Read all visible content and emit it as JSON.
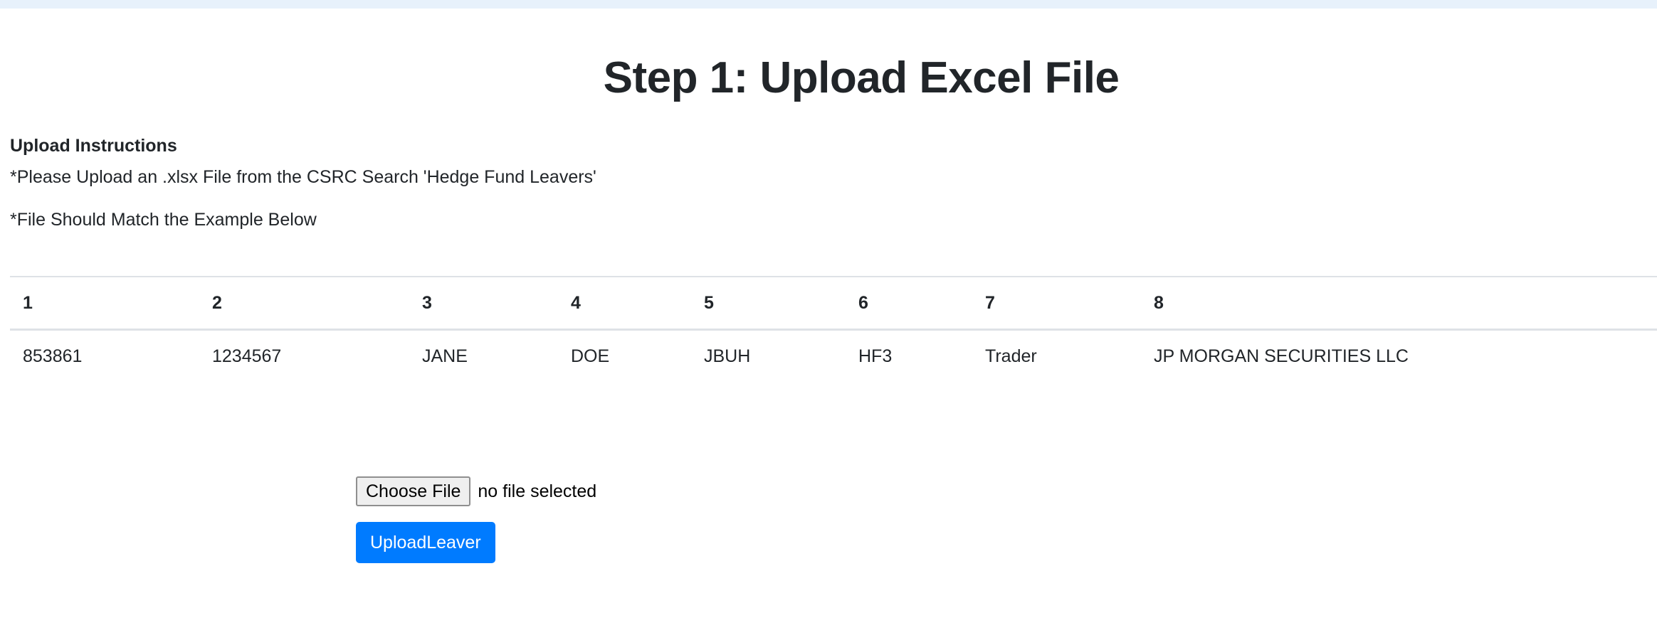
{
  "page": {
    "title": "Step 1: Upload Excel File"
  },
  "instructions": {
    "heading": "Upload Instructions",
    "line1": "*Please Upload an .xlsx File from the CSRC Search 'Hedge Fund Leavers'",
    "line2": "*File Should Match the Example Below"
  },
  "example_table": {
    "headers": [
      "1",
      "2",
      "3",
      "4",
      "5",
      "6",
      "7",
      "8"
    ],
    "rows": [
      [
        "853861",
        "1234567",
        "JANE",
        "DOE",
        "JBUH",
        "HF3",
        "Trader",
        "JP MORGAN SECURITIES LLC"
      ]
    ]
  },
  "upload_form": {
    "choose_file_label": "Choose File",
    "file_status": "no file selected",
    "submit_label": "UploadLeaver"
  },
  "colors": {
    "primary": "#007bff",
    "top_strip": "#e7f1fb",
    "text": "#212529"
  }
}
